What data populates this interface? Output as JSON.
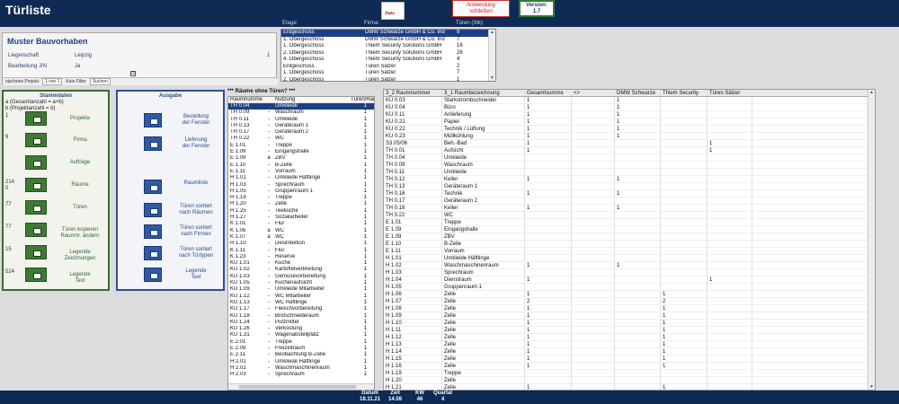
{
  "header": {
    "title": "Türliste",
    "logo_text": "Duke",
    "close_line1": "Anwendung",
    "close_line2": "schließen",
    "version_label": "Version:",
    "version_value": "1.7",
    "colors": {
      "background": "#0e2a55",
      "close_text": "#d02020",
      "version_border": "#2f7d2f"
    }
  },
  "project": {
    "title": "Muster Bauvorhaben",
    "rows": [
      {
        "label": "Liegenschaft",
        "value": "Leipzig",
        "extra": "1"
      },
      {
        "label": "Bearbeitung J/N",
        "value": "Ja",
        "extra": ""
      }
    ],
    "checkbox": "☑",
    "toolbar": {
      "next": "nächstes Projekt",
      "nav": "1 von 1",
      "filter": "Kein Filter",
      "search": "Suchen"
    }
  },
  "floors": {
    "headers": [
      "Etage:",
      "Firma:",
      "Türen (Stk)"
    ],
    "rows": [
      [
        "Erdgeschoss",
        "DMW Schwarze GmbH & Co. Ind",
        "9"
      ],
      [
        "1. Obergeschoss",
        "DMW Schwarze GmbH & Co. Ind",
        "7"
      ],
      [
        "1. Obergeschoss",
        "Thiem Security Solutions GmbH",
        "16"
      ],
      [
        "2. Obergeschoss",
        "Thiem Security Solutions GmbH",
        "26"
      ],
      [
        "4. Obergeschoss",
        "Thiem Security Solutions GmbH",
        "4"
      ],
      [
        "Erdgeschoss",
        "Türen Sälzer",
        "2"
      ],
      [
        "1. Obergeschoss",
        "Türen Sälzer",
        "7"
      ],
      [
        "2. Obergeschoss",
        "Türen Sälzer",
        "1"
      ],
      [
        "3. Obergeschoss",
        "Türen Sälzer",
        "2"
      ]
    ]
  },
  "stamm": {
    "title": "Stammdaten",
    "legend": [
      "a     (Gesamtanzahl = a+b)",
      "b     (Projektanzahl    = b)"
    ],
    "items": [
      {
        "count": "1",
        "label": "Projekte"
      },
      {
        "count": "9",
        "label": "Firma"
      },
      {
        "count": "",
        "label": "Aufträge"
      },
      {
        "count": "214\n0",
        "label": "Räume"
      },
      {
        "count": "77",
        "label": "Türen"
      },
      {
        "count": "77",
        "label": "Türen kopieren\nRaumnr. ändern"
      },
      {
        "count": "15",
        "label": "Legende\nZeichnungen"
      },
      {
        "count": "524",
        "label": "Legende\nText"
      }
    ]
  },
  "ausgabe": {
    "title": "Ausgabe",
    "items": [
      {
        "label": "Bestellung\nder Fenster"
      },
      {
        "label": "Lieferung\nder Fenster"
      },
      {
        "label": "Raumliste"
      },
      {
        "label": "Türen sortiert\nnach Räumen"
      },
      {
        "label": "Türen sortiert\nnach Firmen"
      },
      {
        "label": "Türen sortiert\nnach Türtypen"
      },
      {
        "label": "Legende\nText"
      }
    ]
  },
  "rooms": {
    "title": "*** Räume ohne Türen? ***",
    "headers": [
      "Raumnummer",
      "Nutzung",
      "Türen/Raum"
    ],
    "rows": [
      [
        "TH 0.04",
        "",
        "Umkleide",
        "1"
      ],
      [
        "TH 0.09",
        "-",
        "Waschraum",
        "1"
      ],
      [
        "TH 0.11",
        "-",
        "Umkleide",
        "1"
      ],
      [
        "TH 0.13",
        "-",
        "Geräteraum 1",
        "1"
      ],
      [
        "TH 0.17",
        "-",
        "Geräteraum 2",
        "1"
      ],
      [
        "TH 0.22",
        "-",
        "WC",
        "1"
      ],
      [
        "E 1.01",
        "-",
        "Treppe",
        "1"
      ],
      [
        "E 1.09",
        "-",
        "Eingangshalle",
        "1"
      ],
      [
        "E 1.09",
        "a",
        "ZBV",
        "1"
      ],
      [
        "E 1.10",
        "-",
        "B-Zelle",
        "1"
      ],
      [
        "E 1.11",
        "-",
        "Vorraum",
        "1"
      ],
      [
        "H 1.01",
        "-",
        "Umkleide Häftlinge",
        "1"
      ],
      [
        "H 1.03",
        "-",
        "Sprechraum",
        "1"
      ],
      [
        "H 1.05",
        "-",
        "Gruppenraum 1",
        "1"
      ],
      [
        "H 1.19",
        "-",
        "Treppe",
        "1"
      ],
      [
        "H 1.20",
        "-",
        "Zelle",
        "1"
      ],
      [
        "H 1.25",
        "-",
        "Teeküche",
        "1"
      ],
      [
        "H 1.27",
        "-",
        "Sozialarbeiter",
        "1"
      ],
      [
        "K 1.01",
        "-",
        "Flur",
        "1"
      ],
      [
        "K 1.06",
        "a",
        "WC",
        "1"
      ],
      [
        "K 1.07",
        "a",
        "WC",
        "1"
      ],
      [
        "H 1.10",
        "-",
        "Desinfektion",
        "1"
      ],
      [
        "K 1.11",
        "-",
        "Flur",
        "1"
      ],
      [
        "K 1.23",
        "-",
        "Reserve",
        "1"
      ],
      [
        "KÜ 1.01",
        "-",
        "Küche",
        "1"
      ],
      [
        "KÜ 1.02",
        "-",
        "Kartoffelverbreitung",
        "1"
      ],
      [
        "KÜ 1.03",
        "-",
        "Gemüsevorbereitung",
        "1"
      ],
      [
        "KÜ 1.05",
        "-",
        "Küchenaufsicht",
        "1"
      ],
      [
        "KÜ 1.09",
        "-",
        "Umkleide Mitarbeiter",
        "1"
      ],
      [
        "KÜ 1.12",
        "-",
        "WC Mitarbeiter",
        "1"
      ],
      [
        "KÜ 1.13",
        "-",
        "WC Häftlinge",
        "1"
      ],
      [
        "KÜ 1.17",
        "-",
        "Fleischvorbereitung",
        "1"
      ],
      [
        "KÜ 1.18",
        "-",
        "Brotschneideraum",
        "1"
      ],
      [
        "KÜ 1.24",
        "-",
        "Putzmittel",
        "1"
      ],
      [
        "KÜ 1.26",
        "-",
        "Verkostung",
        "1"
      ],
      [
        "KÜ 1.31",
        "-",
        "Wagenabstellplatz",
        "1"
      ],
      [
        "E 2.01",
        "-",
        "Treppe",
        "1"
      ],
      [
        "E 2.09",
        "-",
        "Freizeitraum",
        "1"
      ],
      [
        "E 2.11",
        "-",
        "Beobachtung B-Zelle",
        "1"
      ],
      [
        "H 2.01",
        "-",
        "Umkleide Häftlinge",
        "1"
      ],
      [
        "H 2.02",
        "-",
        "Waschmaschinenraum",
        "1"
      ],
      [
        "H 2.03",
        "-",
        "Sprechraum",
        "1"
      ]
    ]
  },
  "sheet": {
    "headers": [
      "3_2 Raumnummer",
      "3_1 Raumbezeichnung",
      "Gesamtsumme",
      "<>",
      "DMW Schwarze",
      "Thiem Security",
      "Türen Sälzer"
    ],
    "rows": [
      [
        "KÜ 0.03",
        "Starkstrombschneider",
        "1",
        "",
        "1",
        "",
        ""
      ],
      [
        "KÜ 0.04",
        "Büro",
        "1",
        "",
        "1",
        "",
        ""
      ],
      [
        "KÜ 0.11",
        "Anlieferung",
        "1",
        "",
        "1",
        "",
        ""
      ],
      [
        "KÜ 0.21",
        "Papier",
        "1",
        "",
        "1",
        "",
        ""
      ],
      [
        "KÜ 0.22",
        "Technik / Lüftung",
        "1",
        "",
        "1",
        "",
        ""
      ],
      [
        "KÜ 0.23",
        "Müllkühlung",
        "1",
        "",
        "1",
        "",
        ""
      ],
      [
        "S3.05/06",
        "Beh.-Bad",
        "1",
        "",
        "",
        "",
        "1"
      ],
      [
        "TH 0.01",
        "Aufsicht",
        "1",
        "",
        "",
        "",
        "1"
      ],
      [
        "TH 0.04",
        "Umkleide",
        "",
        "",
        "",
        "",
        ""
      ],
      [
        "TH 0.09",
        "Waschraum",
        "",
        "",
        "",
        "",
        ""
      ],
      [
        "TH 0.11",
        "Umkleide",
        "",
        "",
        "",
        "",
        ""
      ],
      [
        "TH 0.12",
        "Keller",
        "1",
        "",
        "1",
        "",
        ""
      ],
      [
        "TH 0.13",
        "Geräteraum 1",
        "",
        "",
        "",
        "",
        ""
      ],
      [
        "TH 0.16",
        "Technik",
        "1",
        "",
        "1",
        "",
        ""
      ],
      [
        "TH 0.17",
        "Geräteraum 2",
        "",
        "",
        "",
        "",
        ""
      ],
      [
        "TH 0.18",
        "Keller",
        "1",
        "",
        "1",
        "",
        ""
      ],
      [
        "TH 0.22",
        "WC",
        "",
        "",
        "",
        "",
        ""
      ],
      [
        "E 1.01",
        "Treppe",
        "",
        "",
        "",
        "",
        ""
      ],
      [
        "E 1.09",
        "Eingangshalle",
        "",
        "",
        "",
        "",
        ""
      ],
      [
        "E 1.09",
        "ZBV",
        "",
        "",
        "",
        "",
        ""
      ],
      [
        "E 1.10",
        "B-Zelle",
        "",
        "",
        "",
        "",
        ""
      ],
      [
        "E 1.11",
        "Vorraum",
        "",
        "",
        "",
        "",
        ""
      ],
      [
        "H 1.01",
        "Umkleide Häftlinge",
        "",
        "",
        "",
        "",
        ""
      ],
      [
        "H 1.02",
        "Waschmaschinenraum",
        "1",
        "",
        "1",
        "",
        ""
      ],
      [
        "H 1.03",
        "Sprechraum",
        "",
        "",
        "",
        "",
        ""
      ],
      [
        "H 1.04",
        "Dienstraum",
        "1",
        "",
        "",
        "",
        "1"
      ],
      [
        "H 1.05",
        "Gruppenraum 1",
        "",
        "",
        "",
        "",
        ""
      ],
      [
        "H 1.06",
        "Zelle",
        "1",
        "",
        "",
        "1",
        ""
      ],
      [
        "H 1.07",
        "Zelle",
        "2",
        "",
        "",
        "2",
        ""
      ],
      [
        "H 1.08",
        "Zelle",
        "1",
        "",
        "",
        "1",
        ""
      ],
      [
        "H 1.09",
        "Zelle",
        "1",
        "",
        "",
        "1",
        ""
      ],
      [
        "H 1.10",
        "Zelle",
        "1",
        "",
        "",
        "1",
        ""
      ],
      [
        "H 1.11",
        "Zelle",
        "1",
        "",
        "",
        "1",
        ""
      ],
      [
        "H 1.12",
        "Zelle",
        "1",
        "",
        "",
        "1",
        ""
      ],
      [
        "H 1.13",
        "Zelle",
        "1",
        "",
        "",
        "1",
        ""
      ],
      [
        "H 1.14",
        "Zelle",
        "1",
        "",
        "",
        "1",
        ""
      ],
      [
        "H 1.15",
        "Zelle",
        "1",
        "",
        "",
        "1",
        ""
      ],
      [
        "H 1.16",
        "Zelle",
        "1",
        "",
        "",
        "1",
        ""
      ],
      [
        "H 1.19",
        "Treppe",
        "",
        "",
        "",
        "",
        ""
      ],
      [
        "H 1.20",
        "Zelle",
        "",
        "",
        "",
        "",
        ""
      ],
      [
        "H 1.21",
        "Zelle",
        "1",
        "",
        "",
        "1",
        ""
      ],
      [
        "H 1.22",
        "Zelle",
        "1",
        "",
        "",
        "1",
        ""
      ],
      [
        "H 1.23",
        "Zelle",
        "1",
        "",
        "",
        "1",
        ""
      ],
      [
        "H 1.24",
        "Zelle",
        "1",
        "",
        "",
        "1",
        ""
      ]
    ]
  },
  "footer": {
    "items": [
      {
        "label": "Datum",
        "value": "18.11.21"
      },
      {
        "label": "Zeit",
        "value": "14.59"
      },
      {
        "label": "KW",
        "value": "46"
      },
      {
        "label": "Quartal",
        "value": "4"
      }
    ]
  }
}
